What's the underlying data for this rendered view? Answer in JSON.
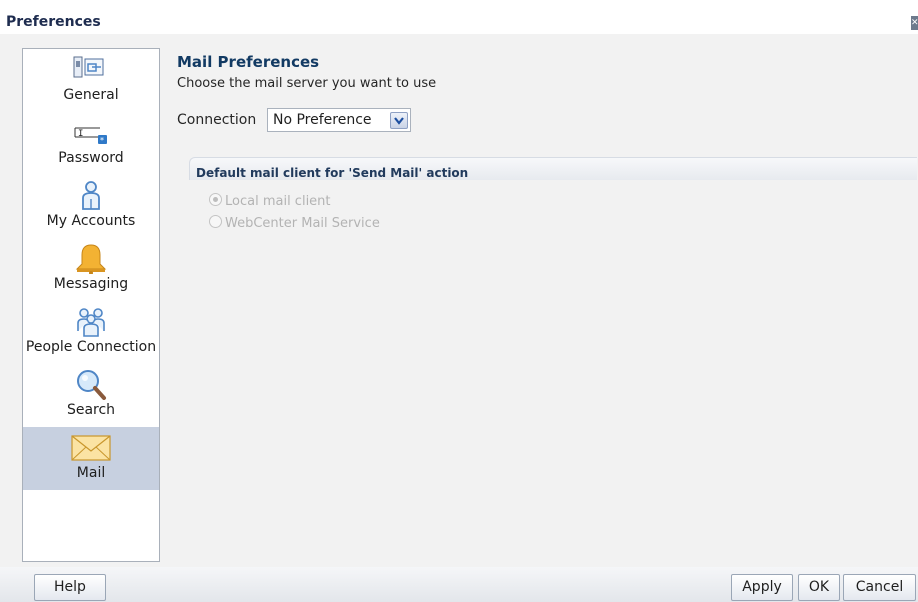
{
  "dialog": {
    "title": "Preferences"
  },
  "sidebar": {
    "items": [
      {
        "label": "General",
        "icon": "general-settings-icon",
        "selected": false
      },
      {
        "label": "Password",
        "icon": "password-field-icon",
        "selected": false
      },
      {
        "label": "My Accounts",
        "icon": "person-icon",
        "selected": false
      },
      {
        "label": "Messaging",
        "icon": "bell-icon",
        "selected": false
      },
      {
        "label": "People Connection",
        "icon": "people-group-icon",
        "selected": false
      },
      {
        "label": "Search",
        "icon": "magnifier-icon",
        "selected": false
      },
      {
        "label": "Mail",
        "icon": "envelope-icon",
        "selected": true
      }
    ]
  },
  "main": {
    "title": "Mail Preferences",
    "subtitle": "Choose the mail server you want to use",
    "connection": {
      "label": "Connection",
      "value": "No Preference"
    },
    "group": {
      "title": "Default mail client for 'Send Mail' action",
      "options": [
        {
          "label": "Local mail client",
          "checked": true,
          "disabled": true
        },
        {
          "label": "WebCenter Mail Service",
          "checked": false,
          "disabled": true
        }
      ]
    }
  },
  "footer": {
    "help": "Help",
    "apply": "Apply",
    "ok": "OK",
    "cancel": "Cancel"
  },
  "colors": {
    "selection": "#c7d0e0",
    "title": "#123a63",
    "icon_blue": "#4f86c6",
    "bell": "#f3b233"
  }
}
